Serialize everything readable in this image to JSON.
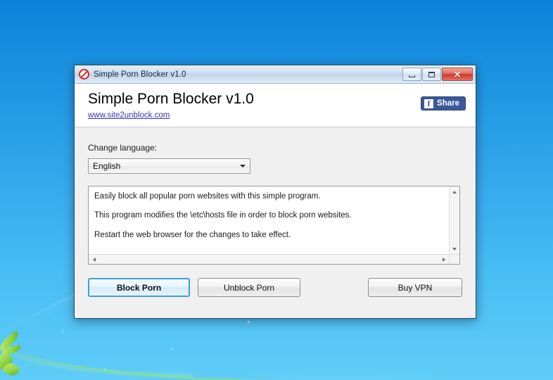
{
  "window": {
    "title": "Simple Porn Blocker v1.0",
    "icon": "prohibition-sign-icon",
    "controls": {
      "minimize": "minimize-icon",
      "maximize": "maximize-icon",
      "close": "✕"
    }
  },
  "header": {
    "app_title": "Simple Porn Blocker v1.0",
    "link_text": "www.site2unblock.com",
    "share": {
      "badge": "f",
      "label": "Share",
      "brand_color": "#3b5998"
    }
  },
  "form": {
    "language_label": "Change language:",
    "language_value": "English",
    "language_options": [
      "English"
    ]
  },
  "info_text": {
    "lines": [
      "Easily block all popular porn websites with this simple program.",
      "This program modifies the \\etc\\hosts file in order to block porn websites.",
      "Restart the web browser for the changes to take effect."
    ]
  },
  "actions": {
    "block_label": "Block Porn",
    "unblock_label": "Unblock Porn",
    "vpn_label": "Buy VPN",
    "default_button": "Block Porn",
    "focus_color": "#3c9fd6"
  },
  "colors": {
    "window_body": "#f0f0f0",
    "header_band": "#ffffff",
    "link": "#3b2fb5",
    "icon_red": "#e02020",
    "desktop_blue": "#1e95e2"
  }
}
